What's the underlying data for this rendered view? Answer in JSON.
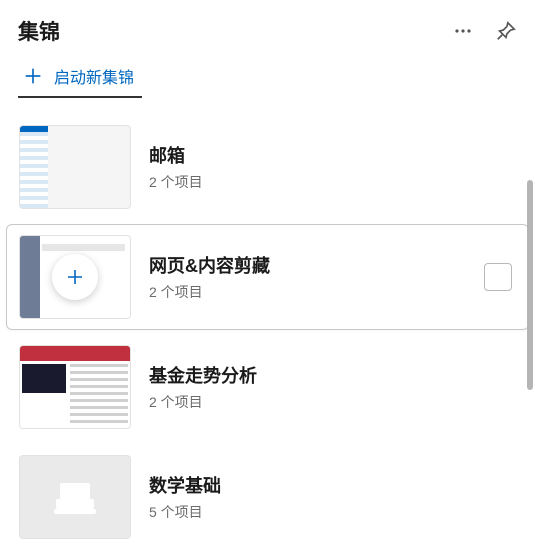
{
  "header": {
    "title": "集锦",
    "new_collection_label": "启动新集锦"
  },
  "icons": {
    "more": "more-icon",
    "pin": "pin-icon",
    "plus": "plus-icon",
    "typewriter": "typewriter-icon"
  },
  "collections": [
    {
      "title": "邮箱",
      "subtitle": "2 个项目",
      "thumb": "mail",
      "selected": false
    },
    {
      "title": "网页&内容剪藏",
      "subtitle": "2 个项目",
      "thumb": "web",
      "selected": true
    },
    {
      "title": "基金走势分析",
      "subtitle": "2 个项目",
      "thumb": "fund",
      "selected": false
    },
    {
      "title": "数学基础",
      "subtitle": "5 个项目",
      "thumb": "empty",
      "selected": false
    }
  ],
  "colors": {
    "accent": "#0067c0"
  }
}
